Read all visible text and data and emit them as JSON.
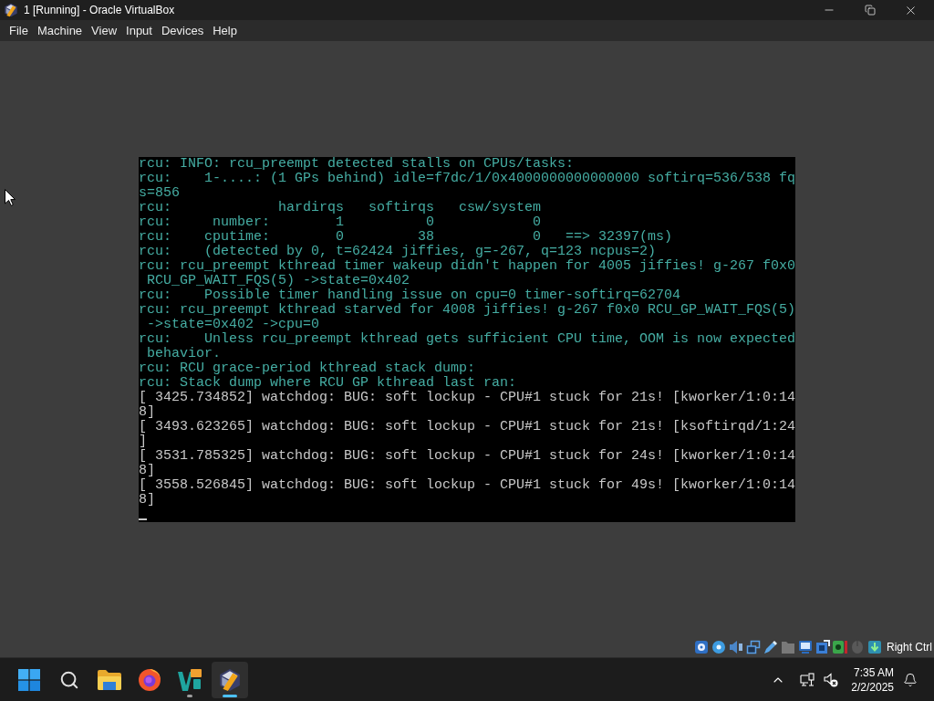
{
  "window": {
    "title": "1 [Running] - Oracle VirtualBox"
  },
  "menu": [
    "File",
    "Machine",
    "View",
    "Input",
    "Devices",
    "Help"
  ],
  "console": {
    "lines": [
      {
        "text": "rcu: INFO: rcu_preempt detected stalls on CPUs/tasks:",
        "kind": "highlighted"
      },
      {
        "text": "rcu:    1-....: (1 GPs behind) idle=f7dc/1/0x4000000000000000 softirq=536/538 fq",
        "kind": "highlighted"
      },
      {
        "text": "s=856",
        "kind": "highlighted"
      },
      {
        "text": "rcu:             hardirqs   softirqs   csw/system",
        "kind": "highlighted"
      },
      {
        "text": "rcu:     number:        1          0            0",
        "kind": "highlighted"
      },
      {
        "text": "rcu:    cputime:        0         38            0   ==> 32397(ms)",
        "kind": "highlighted"
      },
      {
        "text": "rcu:    (detected by 0, t=62424 jiffies, g=-267, q=123 ncpus=2)",
        "kind": "highlighted"
      },
      {
        "text": "rcu: rcu_preempt kthread timer wakeup didn't happen for 4005 jiffies! g-267 f0x0",
        "kind": "highlighted"
      },
      {
        "text": " RCU_GP_WAIT_FQS(5) ->state=0x402",
        "kind": "highlighted"
      },
      {
        "text": "rcu:    Possible timer handling issue on cpu=0 timer-softirq=62704",
        "kind": "highlighted"
      },
      {
        "text": "rcu: rcu_preempt kthread starved for 4008 jiffies! g-267 f0x0 RCU_GP_WAIT_FQS(5)",
        "kind": "highlighted"
      },
      {
        "text": " ->state=0x402 ->cpu=0",
        "kind": "highlighted"
      },
      {
        "text": "rcu:    Unless rcu_preempt kthread gets sufficient CPU time, OOM is now expected",
        "kind": "highlighted"
      },
      {
        "text": " behavior.",
        "kind": "highlighted"
      },
      {
        "text": "rcu: RCU grace-period kthread stack dump:",
        "kind": "highlighted"
      },
      {
        "text": "rcu: Stack dump where RCU GP kthread last ran:",
        "kind": "highlighted"
      },
      {
        "text": "[ 3425.734852] watchdog: BUG: soft lockup - CPU#1 stuck for 21s! [kworker/1:0:14",
        "kind": "normal"
      },
      {
        "text": "8]",
        "kind": "normal"
      },
      {
        "text": "[ 3493.623265] watchdog: BUG: soft lockup - CPU#1 stuck for 21s! [ksoftirqd/1:24",
        "kind": "normal"
      },
      {
        "text": "]",
        "kind": "normal"
      },
      {
        "text": "[ 3531.785325] watchdog: BUG: soft lockup - CPU#1 stuck for 24s! [kworker/1:0:14",
        "kind": "normal"
      },
      {
        "text": "8]",
        "kind": "normal"
      },
      {
        "text": "[ 3558.526845] watchdog: BUG: soft lockup - CPU#1 stuck for 49s! [kworker/1:0:14",
        "kind": "normal"
      },
      {
        "text": "8]",
        "kind": "normal"
      }
    ],
    "cursor_visible": true
  },
  "status_bar": {
    "indicators": [
      {
        "kind": "hard_disk",
        "enabled": true
      },
      {
        "kind": "optical_drive",
        "enabled": true
      },
      {
        "kind": "audio",
        "enabled": true
      },
      {
        "kind": "network",
        "enabled": true
      },
      {
        "kind": "usb",
        "enabled": true
      },
      {
        "kind": "shared_folders",
        "enabled": false
      },
      {
        "kind": "display",
        "enabled": true
      },
      {
        "kind": "recording",
        "enabled": true
      },
      {
        "kind": "features",
        "enabled": true
      },
      {
        "kind": "mouse",
        "enabled": false
      },
      {
        "kind": "keyboard",
        "enabled": true
      }
    ],
    "host_key": "Right Ctrl"
  },
  "taskbar": {
    "apps": [
      {
        "kind": "start",
        "running": false,
        "selected": false
      },
      {
        "kind": "search",
        "running": false,
        "selected": false
      },
      {
        "kind": "folder",
        "running": false,
        "selected": false
      },
      {
        "kind": "browser",
        "running": false,
        "selected": false
      },
      {
        "kind": "editor",
        "running": true,
        "selected": false
      },
      {
        "kind": "virtualbox",
        "running": true,
        "selected": true
      }
    ],
    "clock": {
      "time": "7:35 AM",
      "date": "2/2/2025"
    }
  }
}
